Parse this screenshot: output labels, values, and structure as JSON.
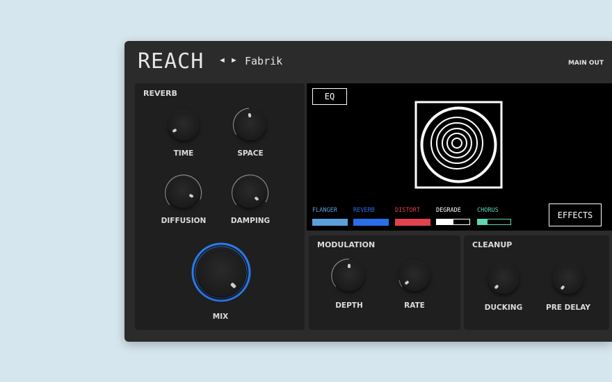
{
  "header": {
    "logo": "REACH",
    "prev_arrow": "◄",
    "next_arrow": "►",
    "preset_name": "Fabrik",
    "main_out": "MAIN OUT"
  },
  "reverb": {
    "title": "REVERB",
    "knobs": {
      "time": "TIME",
      "space": "SPACE",
      "diffusion": "DIFFUSION",
      "damping": "DAMPING",
      "mix": "MIX"
    }
  },
  "display": {
    "eq_button": "EQ",
    "effects_button": "EFFECTS",
    "effects": [
      {
        "label": "FLANGER",
        "color": "#5aa0dc",
        "fill": 1.0
      },
      {
        "label": "REVERB",
        "color": "#2a6ee8",
        "fill": 1.0
      },
      {
        "label": "DISTORT",
        "color": "#e0434c",
        "fill": 1.0
      },
      {
        "label": "DEGRADE",
        "color": "#ffffff",
        "fill": 0.5
      },
      {
        "label": "CHORUS",
        "color": "#5fd6b6",
        "fill": 0.3
      }
    ]
  },
  "modulation": {
    "title": "MODULATION",
    "knobs": {
      "depth": "DEPTH",
      "rate": "RATE"
    }
  },
  "cleanup": {
    "title": "CLEANUP",
    "knobs": {
      "ducking": "DUCKING",
      "pre_delay": "PRE DELAY"
    }
  },
  "colors": {
    "accent_blue": "#2a7bf0",
    "panel": "#1f1f1f",
    "body": "#2b2b2b"
  }
}
